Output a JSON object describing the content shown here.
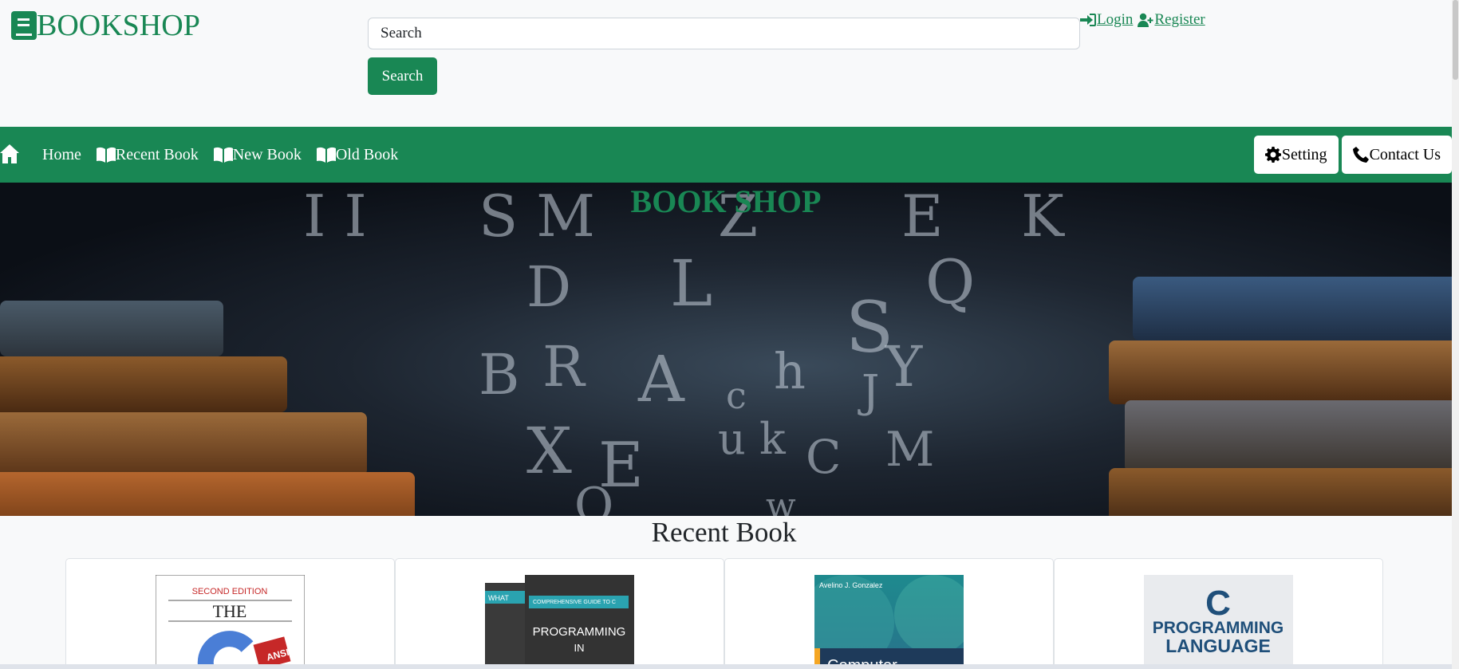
{
  "header": {
    "brand": "BOOKSHOP",
    "search_placeholder": "Search",
    "search_button": "Search",
    "login": "Login",
    "register": "Register"
  },
  "nav": {
    "home": "Home",
    "recent": "Recent Book",
    "new": "New Book",
    "old": "Old Book",
    "setting": "Setting",
    "contact": "Contact Us"
  },
  "hero": {
    "title": "BOOK SHOP"
  },
  "recent": {
    "title": "Recent Book",
    "books": [
      {
        "edition": "SECOND EDITION",
        "cover_title": "THE",
        "badge": "ANSI"
      },
      {
        "tab": "WHAT",
        "series": "COMPREHENSIVE GUIDE TO C",
        "cover_title": "PROGRAMMING",
        "sub": "IN"
      },
      {
        "author": "Avelino J. Gonzalez",
        "cover_title": "Computer"
      },
      {
        "letter": "C",
        "cover_title": "PROGRAMMING",
        "sub": "LANGUAGE"
      }
    ]
  },
  "colors": {
    "brand": "#198754",
    "background": "#f8f9fa"
  }
}
